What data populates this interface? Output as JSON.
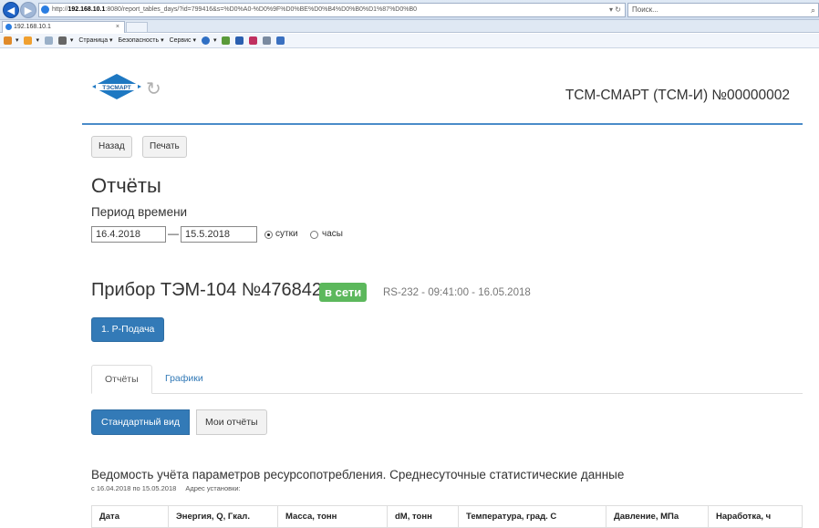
{
  "browser": {
    "address_prefix": "http://",
    "address_host": "192.168.10.1",
    "address_rest": ":8080/report_tables_days/?id=799416&s=%D0%A0-%D0%9F%D0%BE%D0%B4%D0%B0%D1%87%D0%B0",
    "search_placeholder": "Поиск...",
    "tab_title": "192.168.10.1",
    "tab_close": "×",
    "command_bar": {
      "page": "Страница ▾",
      "safety": "Безопасность ▾",
      "service": "Сервис ▾"
    }
  },
  "header": {
    "logo_text": "ТЭСМАРТ",
    "device_title": "ТСМ-СМАРТ (ТСМ-И) №00000002"
  },
  "actions": {
    "back": "Назад",
    "print": "Печать"
  },
  "page": {
    "title": "Отчёты",
    "period_label": "Период времени",
    "date_from": "16.4.2018",
    "date_sep": "—",
    "date_to": "15.5.2018",
    "radio_days": "сутки",
    "radio_hours": "часы"
  },
  "device": {
    "heading": "Прибор ТЭМ-104 №476842",
    "status": "в сети",
    "connection": "RS-232 - 09:41:00 - 16.05.2018",
    "channel_button": "1. P-Подача"
  },
  "tabs": {
    "reports": "Отчёты",
    "graphs": "Графики"
  },
  "view": {
    "standard": "Стандартный вид",
    "mine": "Мои отчёты"
  },
  "report": {
    "title": "Ведомость учёта параметров ресурсопотребления. Среднесуточные статистические данные",
    "range": "с 16.04.2018 по 15.05.2018",
    "address": "Адрес установки:",
    "columns": [
      "Дата",
      "Энергия, Q, Гкал.",
      "Масса, тонн",
      "dM, тонн",
      "Температура, град. С",
      "Давление, МПа",
      "Наработка, ч"
    ]
  }
}
